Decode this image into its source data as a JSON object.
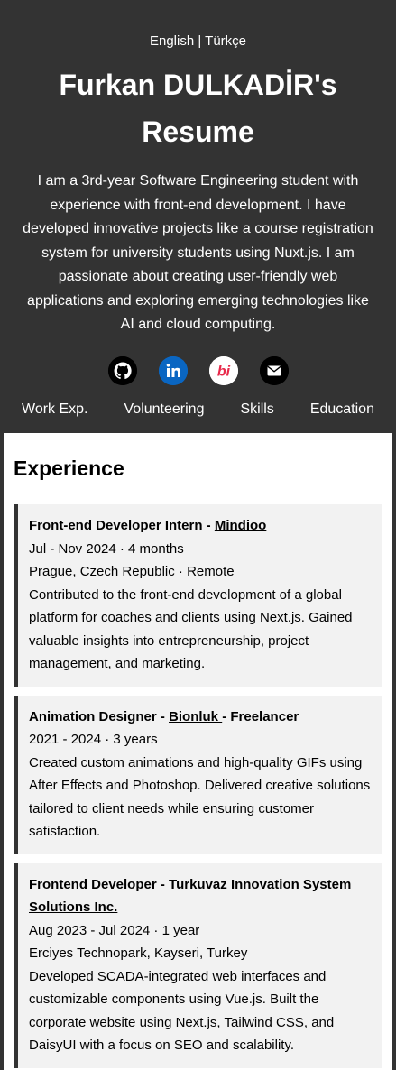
{
  "header": {
    "lang_en": "English",
    "lang_sep": " | ",
    "lang_tr": "Türkçe",
    "name_line1": "Furkan DULKADİR's",
    "name_line2": "Resume",
    "bio": "I am a 3rd-year Software Engineering student with experience with front-end development. I have developed innovative projects like a course registration system for university students using Nuxt.js. I am passionate about creating user-friendly web applications and exploring emerging technologies like AI and cloud computing.",
    "socials": [
      {
        "icon": "github-icon",
        "label": "GitHub"
      },
      {
        "icon": "linkedin-icon",
        "label": "LinkedIn"
      },
      {
        "icon": "bionluk-icon",
        "label": "bi"
      },
      {
        "icon": "email-icon",
        "label": "Email"
      }
    ],
    "nav": [
      "Work Exp.",
      "Volunteering",
      "Skills",
      "Education"
    ]
  },
  "experience": {
    "title": "Experience",
    "items": [
      {
        "role": "Front-end Developer Intern - ",
        "company": "Mindioo",
        "suffix": "",
        "period": "Jul - Nov 2024 · 4 months",
        "location": "Prague, Czech Republic · Remote",
        "description": "Contributed to the front-end development of a global platform for coaches and clients using Next.js. Gained valuable insights into entrepreneurship, project management, and marketing."
      },
      {
        "role": "Animation Designer - ",
        "company": "Bionluk ",
        "suffix": "- Freelancer",
        "period": "2021 - 2024 · 3 years",
        "location": "",
        "description": "Created custom animations and high-quality GIFs using After Effects and Photoshop. Delivered creative solutions tailored to client needs while ensuring customer satisfaction."
      },
      {
        "role": "Frontend Developer - ",
        "company": "Turkuvaz Innovation System Solutions Inc.",
        "suffix": "",
        "period": "Aug 2023 - Jul 2024 · 1 year",
        "location": "Erciyes Technopark, Kayseri, Turkey",
        "description": "Developed SCADA-integrated web interfaces and customizable components using Vue.js. Built the corporate website using Next.js, Tailwind CSS, and DaisyUI with a focus on SEO and scalability."
      }
    ]
  },
  "colors": {
    "header_bg": "#333333",
    "card_bg": "#f2f2f2",
    "linkedin": "#0a66c2",
    "bionluk": "#e8294a"
  }
}
